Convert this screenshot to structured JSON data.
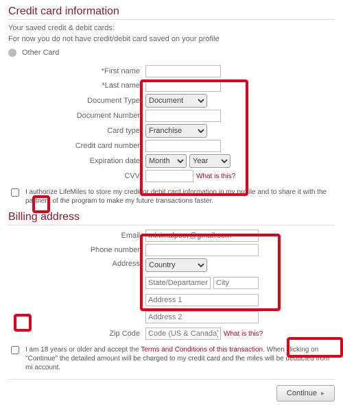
{
  "cc": {
    "heading": "Credit card information",
    "saved_text": "Your saved credit & debit cards:",
    "no_card_text": "For now you do not have credit/debit card saved on your profile",
    "other_card": "Other Card",
    "labels": {
      "first_name": "*First name",
      "last_name": "*Last name",
      "doc_type": "Document Type",
      "doc_number": "Document Number",
      "card_type": "Card type",
      "cc_number": "Credit card number",
      "exp": "Expiration date",
      "cvv": "CVV"
    },
    "selects": {
      "doc_type": "Document",
      "card_type": "Franchise",
      "month": "Month",
      "year": "Year"
    },
    "values": {
      "first_name": "",
      "last_name": "",
      "doc_number": "",
      "cc_number": "",
      "cvv": ""
    },
    "what_is_this": "What is this?",
    "authorize_text": "I authorize LifeMiles to store my credit or debit card information in my profile and to share it with the partners of the program to make my future transactions faster."
  },
  "billing": {
    "heading": "Billing address",
    "labels": {
      "email": "Email",
      "phone": "Phone number",
      "address": "Address",
      "zip": "Zip Code"
    },
    "values": {
      "email": "minimalpoor@gmail.com",
      "phone": ""
    },
    "placeholders": {
      "country": "Country",
      "state": "State/Departament",
      "city": "City",
      "addr1": "Address 1",
      "addr2": "Address 2",
      "zip": "Code (US & Canada)"
    },
    "what_is_this": "What is this?"
  },
  "terms": {
    "prefix": "I am 18 years or older and accept the ",
    "link": "Terms and Conditions of this transaction",
    "suffix": ". When clicking on \"Continue\" the detailed amount will be charged to my credit card and the miles will be deducted from mi account."
  },
  "continue_label": "Continue"
}
